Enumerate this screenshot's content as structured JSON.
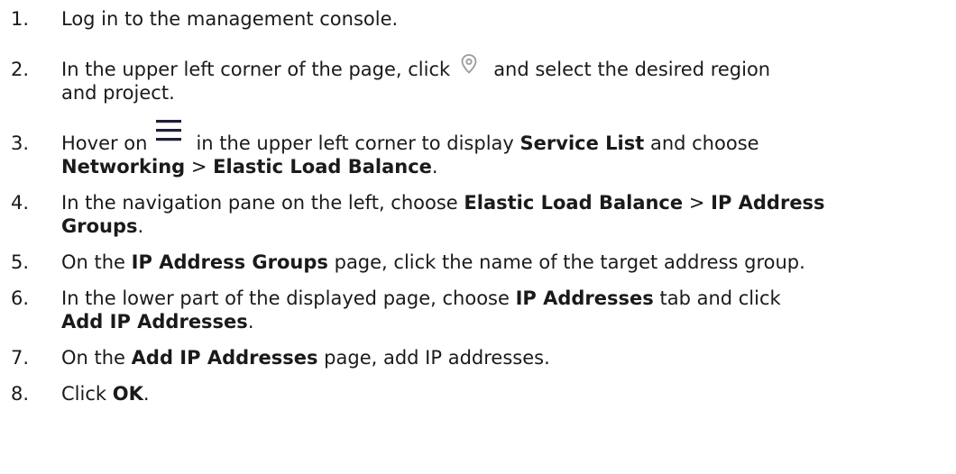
{
  "steps": [
    {
      "number": "1.",
      "text": "Log in to the management console."
    },
    {
      "number": "2.",
      "before_icon": "In the upper left corner of the page, click",
      "icon": "location-pin-icon",
      "after_icon": "and select the desired region",
      "line2": "and project."
    },
    {
      "number": "3.",
      "before_icon": "Hover on",
      "icon": "hamburger-menu-icon",
      "after_icon": "in the upper left corner to display",
      "bold1": "Service List",
      "mid1": "and choose",
      "bold2": "Networking",
      "sep": ">",
      "bold3": "Elastic Load Balance",
      "end": "."
    },
    {
      "number": "4.",
      "pre": "In the navigation pane on the left, choose",
      "bold1": "Elastic Load Balance",
      "sep": ">",
      "bold2": "IP Address",
      "bold3": "Groups",
      "end": "."
    },
    {
      "number": "5.",
      "pre": "On the",
      "bold1": "IP Address Groups",
      "post": "page, click the name of the target address group."
    },
    {
      "number": "6.",
      "pre": "In the lower part of the displayed page, choose",
      "bold1": "IP Addresses",
      "mid": "tab and click",
      "bold2": "Add IP Addresses",
      "end": "."
    },
    {
      "number": "7.",
      "pre": "On the",
      "bold1": "Add IP Addresses",
      "post": "page, add IP addresses."
    },
    {
      "number": "8.",
      "pre": "Click",
      "bold1": "OK",
      "end": "."
    }
  ]
}
